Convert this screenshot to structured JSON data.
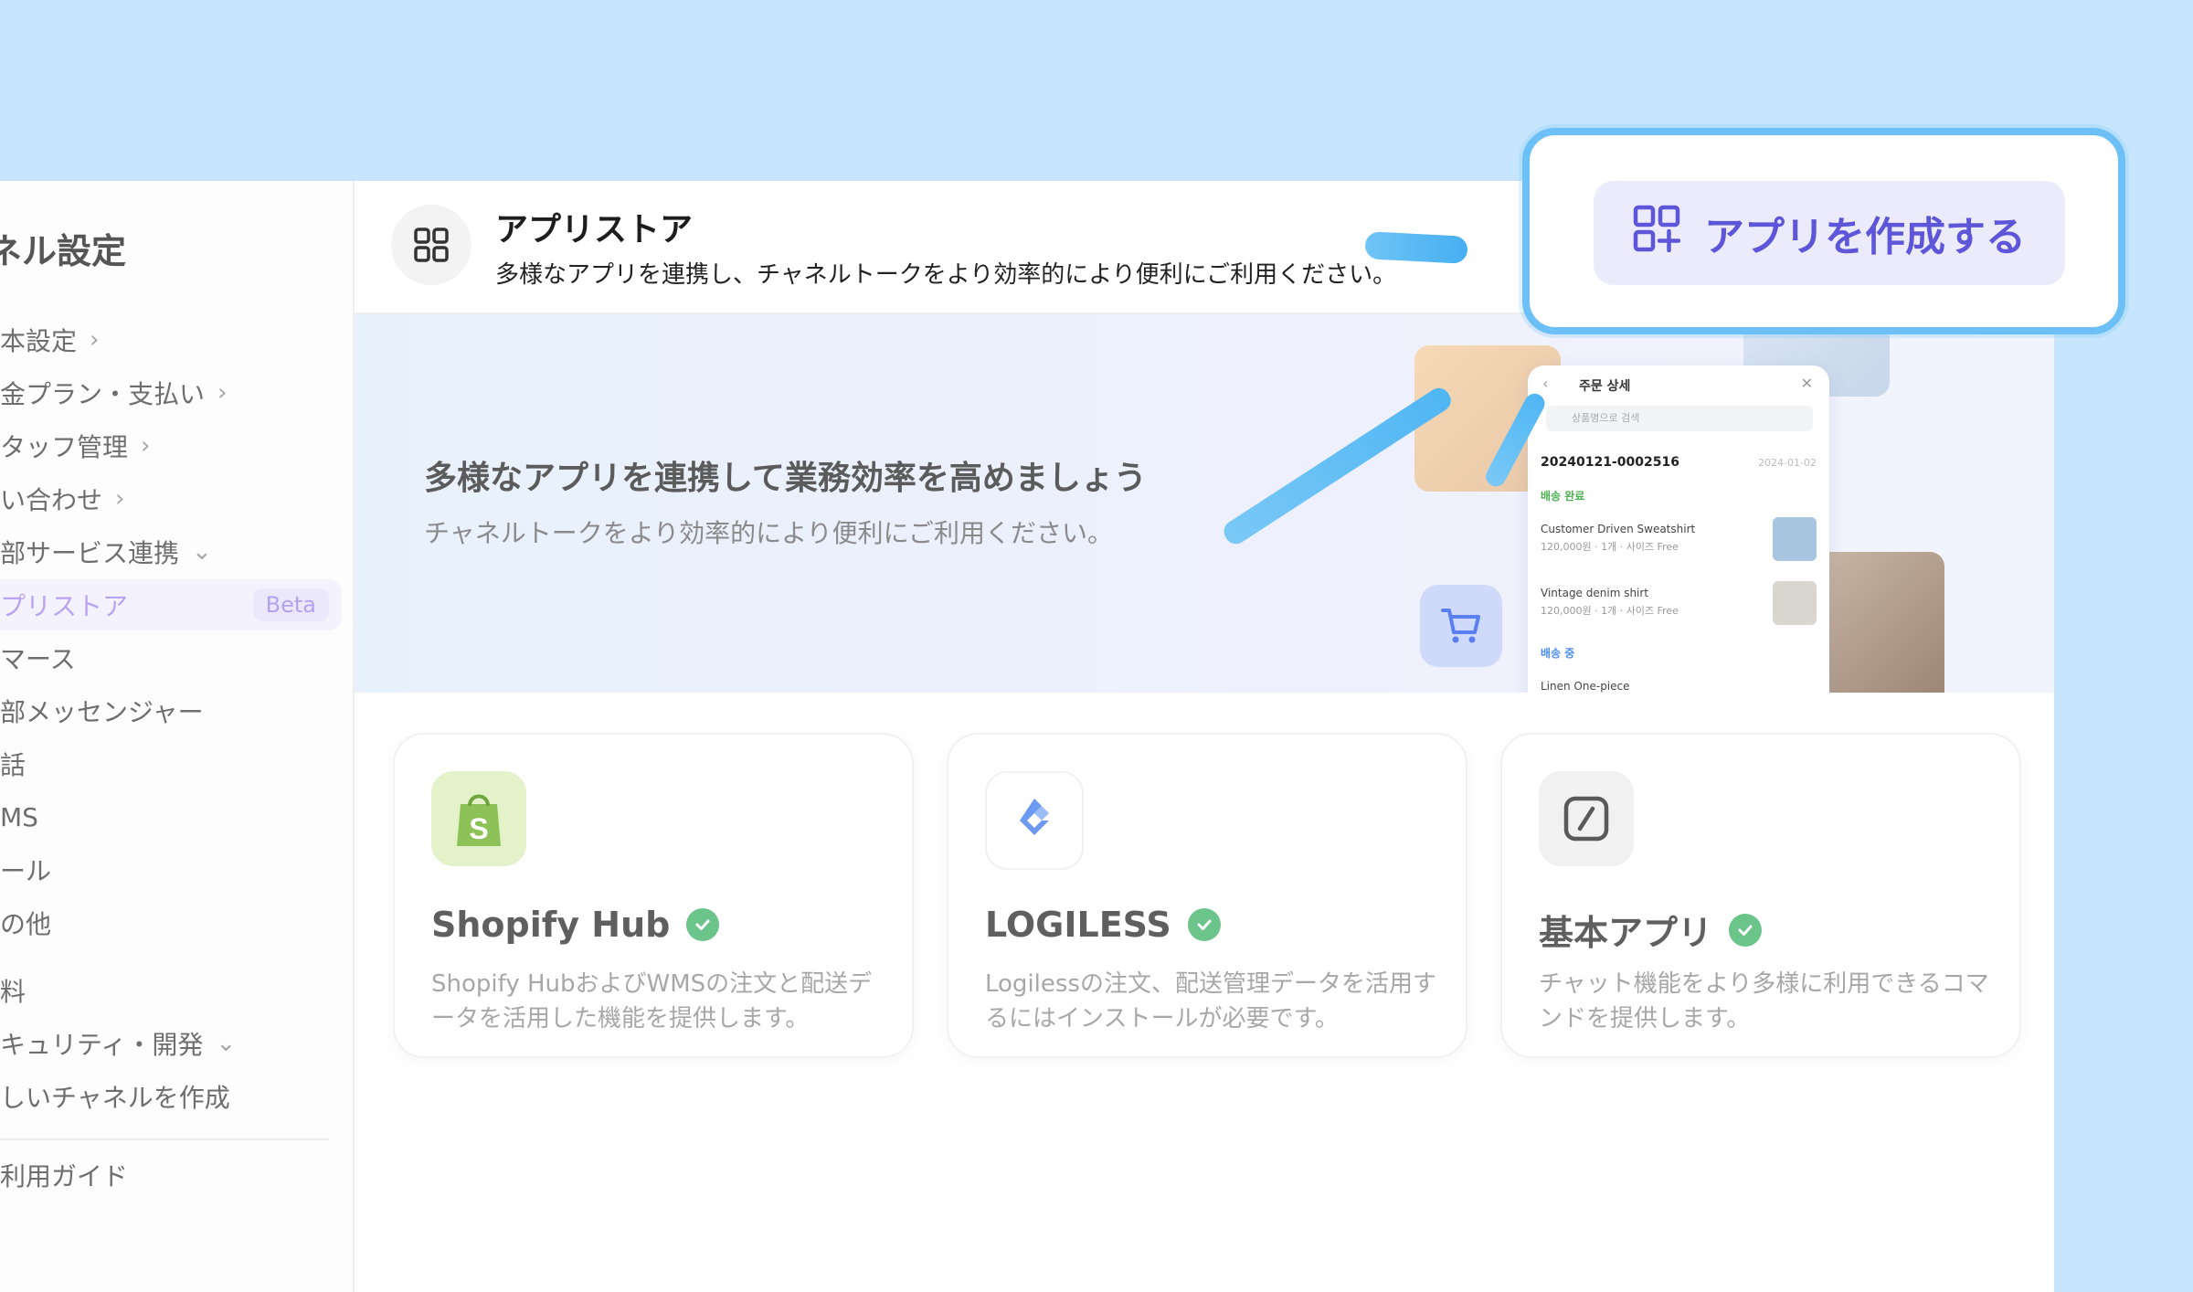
{
  "sidebar": {
    "title": "ネル設定",
    "items": [
      {
        "label": "本設定",
        "chev": "›"
      },
      {
        "label": "金プラン・支払い",
        "chev": "›"
      },
      {
        "label": "タッフ管理",
        "chev": "›"
      },
      {
        "label": "い合わせ",
        "chev": "›"
      },
      {
        "label": "部サービス連携",
        "chev": "⌄"
      },
      {
        "label": "プリストア",
        "badge": "Beta"
      },
      {
        "label": "マース"
      },
      {
        "label": "部メッセンジャー"
      },
      {
        "label": "話"
      },
      {
        "label": "MS"
      },
      {
        "label": "ール"
      },
      {
        "label": "の他"
      },
      {
        "label": "料"
      },
      {
        "label": "キュリティ・開発",
        "chev": "⌄"
      },
      {
        "label": "しいチャネルを作成"
      },
      {
        "label": "利用ガイド"
      }
    ]
  },
  "header": {
    "icon": "grid-icon",
    "title": "アプリストア",
    "subtitle": "多様なアプリを連携し、チャネルトークをより効率的により便利にご利用ください。"
  },
  "banner": {
    "title": "多様なアプリを連携して業務効率を高めましょう",
    "subtitle": "チャネルトークをより効率的により便利にご利用ください。",
    "mock": {
      "back": "‹",
      "header": "주문 상세",
      "close": "✕",
      "search_placeholder": "상품명으로 검색",
      "order_id": "20240121-0002516",
      "order_date": "2024-01-02",
      "status_done": "배송 완료",
      "items": [
        {
          "name": "Customer Driven Sweatshirt",
          "price": "120,000원 · 1개 · 사이즈 Free"
        },
        {
          "name": "Vintage denim shirt",
          "price": "120,000원 · 1개 · 사이즈 Free"
        }
      ],
      "status_shipping": "배송 중",
      "item3": "Linen One-piece"
    }
  },
  "cards": [
    {
      "title": "Shopify Hub",
      "desc": "Shopify HubおよびWMSの注文と配送データを活用した機能を提供します。",
      "logo_color": "#e3f2c9",
      "icon": "shopify-bag-icon"
    },
    {
      "title": "LOGILESS",
      "desc": "Logilessの注文、配送管理データを活用するにはインストールが必要です。",
      "logo_color": "#ffffff",
      "icon": "logiless-diamond-icon"
    },
    {
      "title": "基本アプリ",
      "desc": "チャット機能をより多様に利用できるコマンドを提供します。",
      "logo_color": "#f1f1f1",
      "icon": "slash-square-icon"
    }
  ],
  "callout": {
    "create_button_label": "アプリを作成する",
    "icon": "grid-plus-icon"
  },
  "colors": {
    "accent": "#5d56d8",
    "highlight": "#6dc0f6",
    "verified": "#6bc58a"
  }
}
